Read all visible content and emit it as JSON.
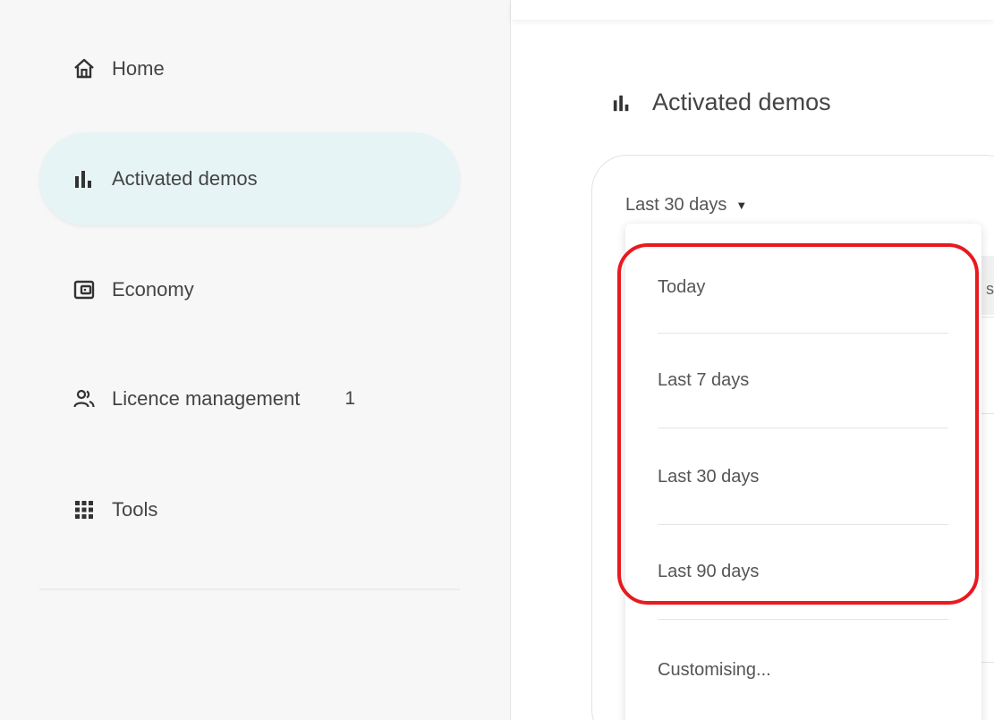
{
  "sidebar": {
    "items": [
      {
        "label": "Home",
        "icon": "home-icon"
      },
      {
        "label": "Activated demos",
        "icon": "bar-chart-icon",
        "active": true
      },
      {
        "label": "Economy",
        "icon": "wallet-icon"
      },
      {
        "label": "Licence management",
        "icon": "people-icon",
        "badge": "1"
      },
      {
        "label": "Tools",
        "icon": "grid-icon"
      }
    ]
  },
  "main": {
    "title": "Activated demos",
    "range_select": {
      "value": "Last 30 days"
    },
    "dropdown": {
      "options": [
        "Today",
        "Last 7 days",
        "Last 30 days",
        "Last 90 days",
        "Customising..."
      ]
    },
    "partial_text": "s"
  },
  "colors": {
    "active_nav_bg": "#e6f4f5",
    "highlight": "#e8191f",
    "sidebar_bg": "#f7f7f7"
  }
}
